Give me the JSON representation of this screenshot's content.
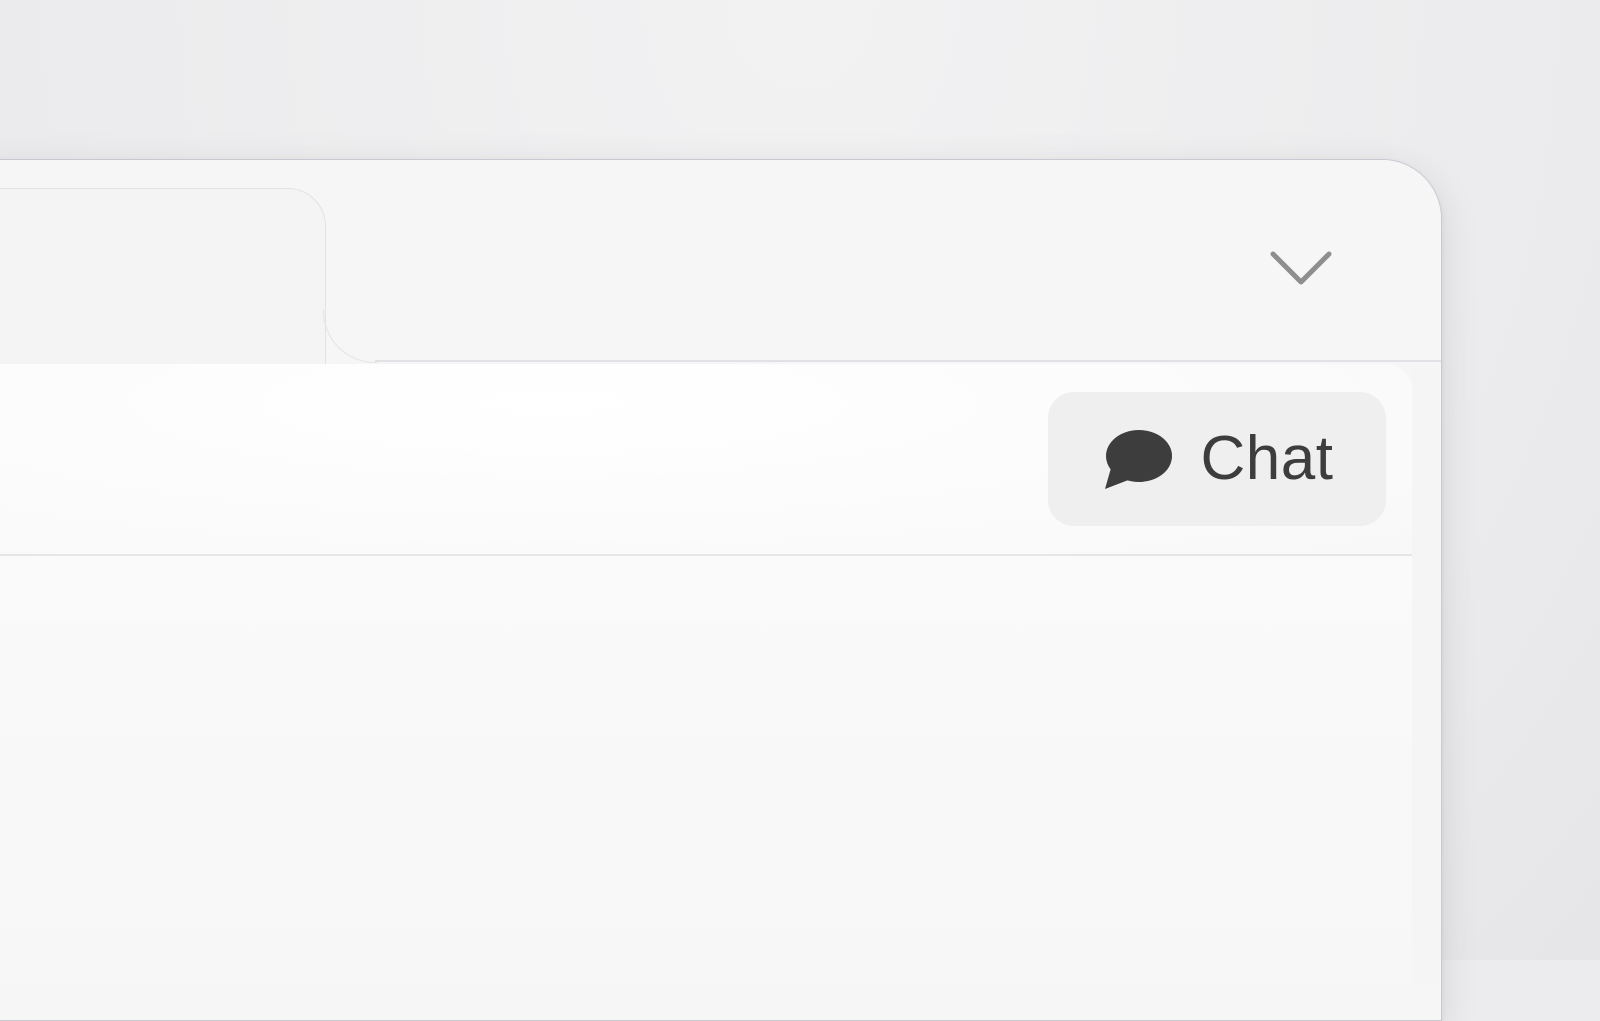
{
  "header": {
    "chat_button": {
      "label": "Chat",
      "icon": "speech-bubble-icon"
    }
  },
  "tabbar": {
    "expand_icon": "chevron-down-icon"
  },
  "colors": {
    "window_bg": "#f6f6f7",
    "content_bg": "#fbfbfb",
    "button_bg": "#efeff0",
    "text": "#3d3d3d",
    "chevron": "#8e8e8e"
  }
}
